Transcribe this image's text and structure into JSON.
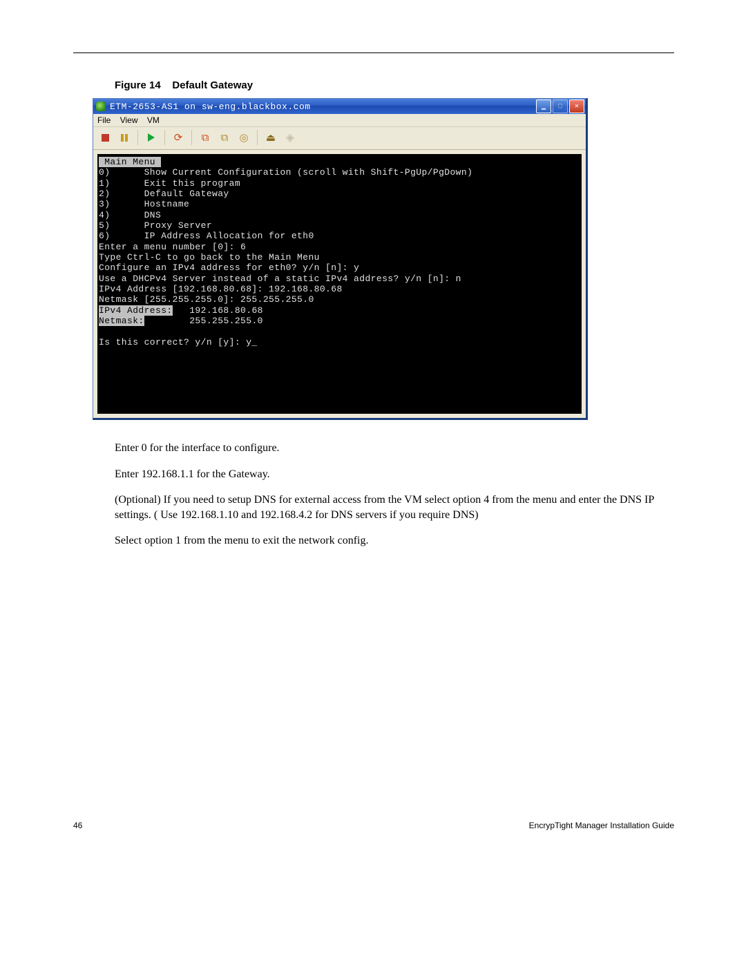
{
  "figure": {
    "label": "Figure 14",
    "title": "Default Gateway"
  },
  "window": {
    "title": "ETM-2653-AS1 on sw-eng.blackbox.com",
    "menus": {
      "file": "File",
      "view": "View",
      "vm": "VM"
    },
    "toolbar_icons": {
      "stop": "stop-icon",
      "pause": "pause-icon",
      "play": "play-icon",
      "reset": "reset-icon",
      "snapshot": "snapshot-icon",
      "snapmgr": "snapshot-manager-icon",
      "cd": "cd-icon",
      "floppy": "floppy-icon",
      "eject": "eject-icon",
      "fullscreen": "fullscreen-icon"
    }
  },
  "terminal": {
    "header": " Main Menu ",
    "lines": [
      "0)      Show Current Configuration (scroll with Shift-PgUp/PgDown)",
      "1)      Exit this program",
      "2)      Default Gateway",
      "3)      Hostname",
      "4)      DNS",
      "5)      Proxy Server",
      "6)      IP Address Allocation for eth0",
      "Enter a menu number [0]: 6",
      "Type Ctrl-C to go back to the Main Menu",
      "",
      "Configure an IPv4 address for eth0? y/n [n]: y",
      "Use a DHCPv4 Server instead of a static IPv4 address? y/n [n]: n",
      "IPv4 Address [192.168.80.68]: 192.168.80.68",
      "Netmask [255.255.255.0]: 255.255.255.0"
    ],
    "inv1_label": "IPv4 Address:",
    "inv1_value": "   192.168.80.68",
    "inv2_label": "Netmask:",
    "inv2_value": "        255.255.255.0",
    "prompt": "Is this correct? y/n [y]: y_"
  },
  "body": {
    "p1": "Enter 0 for the interface to configure.",
    "p2": "Enter 192.168.1.1 for the Gateway.",
    "p3": "(Optional) If you need to setup DNS for external access from the VM select option 4 from the menu and enter the DNS IP settings. ( Use 192.168.1.10 and 192.168.4.2 for DNS servers if you require DNS)",
    "p4": "Select option 1 from the menu to exit the network config."
  },
  "footer": {
    "page": "46",
    "doc": "EncrypTight Manager Installation Guide"
  }
}
